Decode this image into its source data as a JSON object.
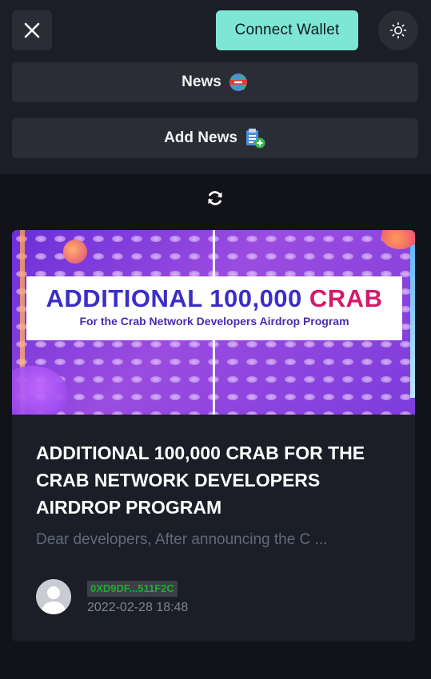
{
  "header": {
    "connect_wallet_label": "Connect Wallet",
    "close_icon": "close-icon",
    "theme_icon": "sun-icon"
  },
  "menu": {
    "news_label": "News",
    "news_icon": "news-globe-icon",
    "add_news_label": "Add News",
    "add_news_icon": "clipboard-add-icon"
  },
  "refresh_icon": "refresh-icon",
  "article": {
    "banner_title_prefix": "ADDITIONAL 100,000 ",
    "banner_title_token": "CRAB",
    "banner_subtitle": "For the Crab Network Developers Airdrop Program",
    "title": "ADDITIONAL 100,000 CRAB FOR THE CRAB NETWORK DEVELOPERS AIRDROP PROGRAM",
    "excerpt": "Dear developers, After announcing the C ...",
    "author_address": "0XD9DF...511F2C",
    "date": "2022-02-28 18:48"
  },
  "colors": {
    "accent": "#7ee6d4",
    "background": "#111319",
    "panel": "#1b1e26",
    "button": "#2a2d35",
    "address_green": "#1fae2c"
  }
}
